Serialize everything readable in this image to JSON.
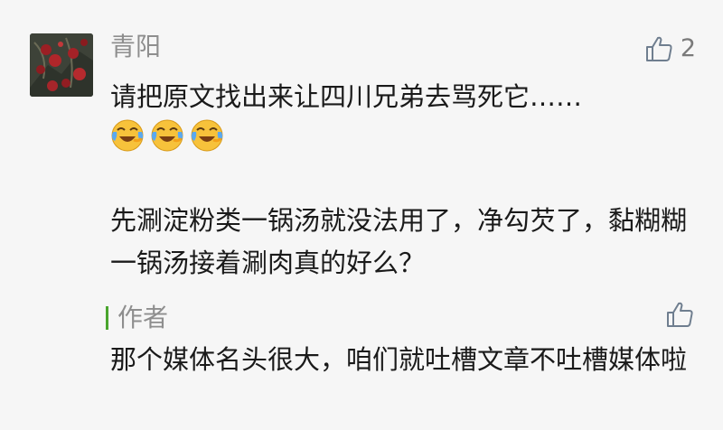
{
  "comment": {
    "nickname": "青阳",
    "like_count": "2",
    "line1": "请把原文找出来让四川兄弟去骂死它……",
    "emoji_count": 3,
    "line2": "先涮淀粉类一锅汤就没法用了，净勾芡了，黏糊糊一锅汤接着涮肉真的好么？"
  },
  "author_reply": {
    "label": "作者",
    "text": "那个媒体名头很大，咱们就吐槽文章不吐槽媒体啦"
  },
  "colors": {
    "background": "#f6f6f6",
    "nickname": "#8e8e8e",
    "text": "#1a1a1a",
    "author_accent": "#4aa52e"
  },
  "icons": {
    "like": "thumbs-up-icon",
    "emoji": "crying-laughing-face"
  }
}
